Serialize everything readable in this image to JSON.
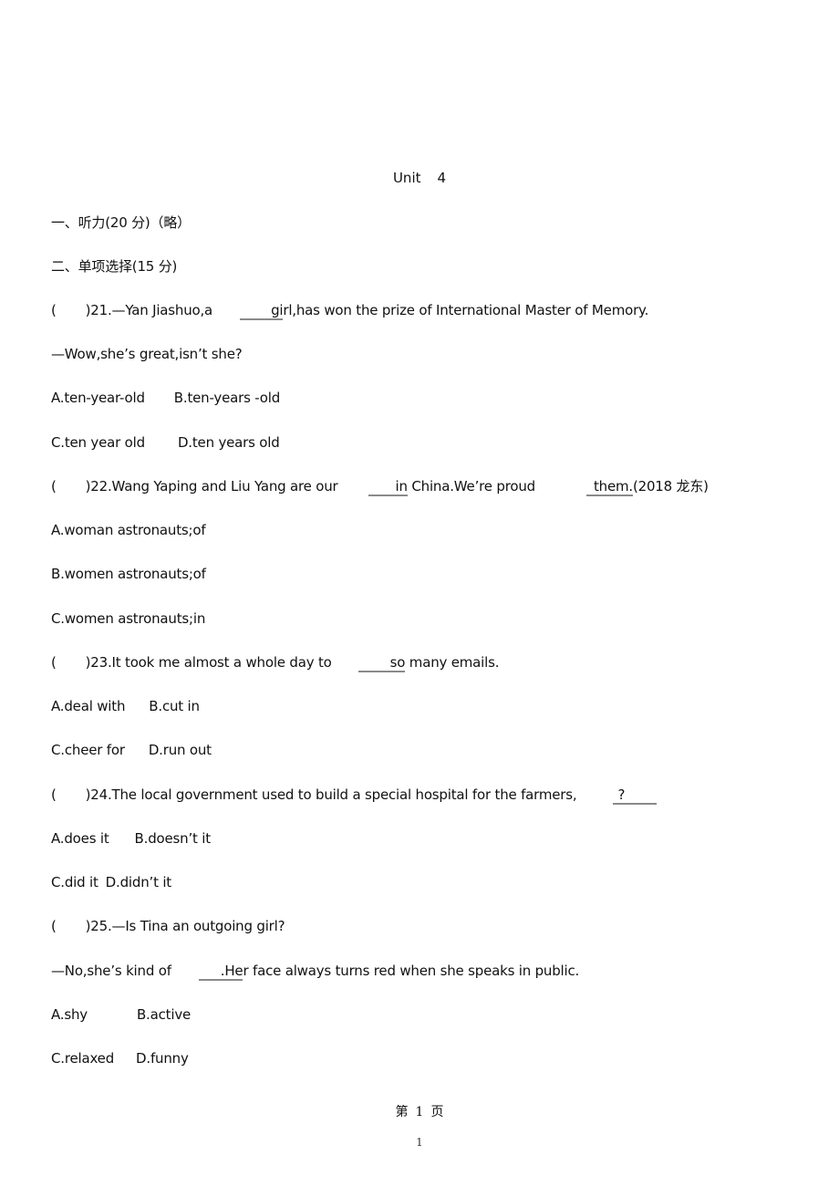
{
  "title": {
    "unit": "Unit",
    "number": "4"
  },
  "sections": {
    "listening": "一、听力(20 分)（略）",
    "single_choice": "二、单项选择(15 分)"
  },
  "questions": [
    {
      "number": "21",
      "stem_before": "(       )21.—Yan Jiashuo,a",
      "blank_text": "gi",
      "stem_after": "rl,has won the prize of International Master of Memory.",
      "line2": "—Wow,she’s great,isn’t she?",
      "options": [
        {
          "a": "A.ten-year-old",
          "b": "B.ten-years -old"
        },
        {
          "a": "C.ten year old",
          "b": "D.ten years old"
        }
      ]
    },
    {
      "number": "22",
      "stem_before": "(       )22.Wang Yaping and Liu Yang are our",
      "blank1_text": "in",
      "stem_mid": " China.We’re proud",
      "blank2_text": "them.",
      "stem_after": "(2018 龙东)",
      "options": [
        "A.woman astronauts;of",
        "B.women astronauts;of",
        "C.women astronauts;in"
      ]
    },
    {
      "number": "23",
      "stem_before": "(       )23.It took me almost a whole day to",
      "blank_text": "so",
      "stem_after": " many emails.",
      "options": [
        {
          "a": "A.deal with",
          "b": "B.cut in"
        },
        {
          "a": "C.cheer for",
          "b": "D.run out"
        }
      ]
    },
    {
      "number": "24",
      "stem_before": "(       )24.The local government used to build a special hospital for the farmers,",
      "blank_text": "?",
      "options": [
        {
          "a": "A.does it",
          "b": "B.doesn’t it"
        },
        {
          "a": "C.did it",
          "b": "D.didn’t it"
        }
      ]
    },
    {
      "number": "25",
      "stem": "(       )25.—Is Tina an outgoing girl?",
      "line2_before": "—No,she’s kind of",
      "blank_text": ".He",
      "line2_after": "r face always turns red when she speaks in public.",
      "options": [
        {
          "a": "A.shy",
          "b": "B.active"
        },
        {
          "a": "C.relaxed",
          "b": "D.funny"
        }
      ]
    }
  ],
  "footer": {
    "page_prefix": "第",
    "page_number": "1",
    "page_suffix": "页",
    "page_index": "1"
  }
}
